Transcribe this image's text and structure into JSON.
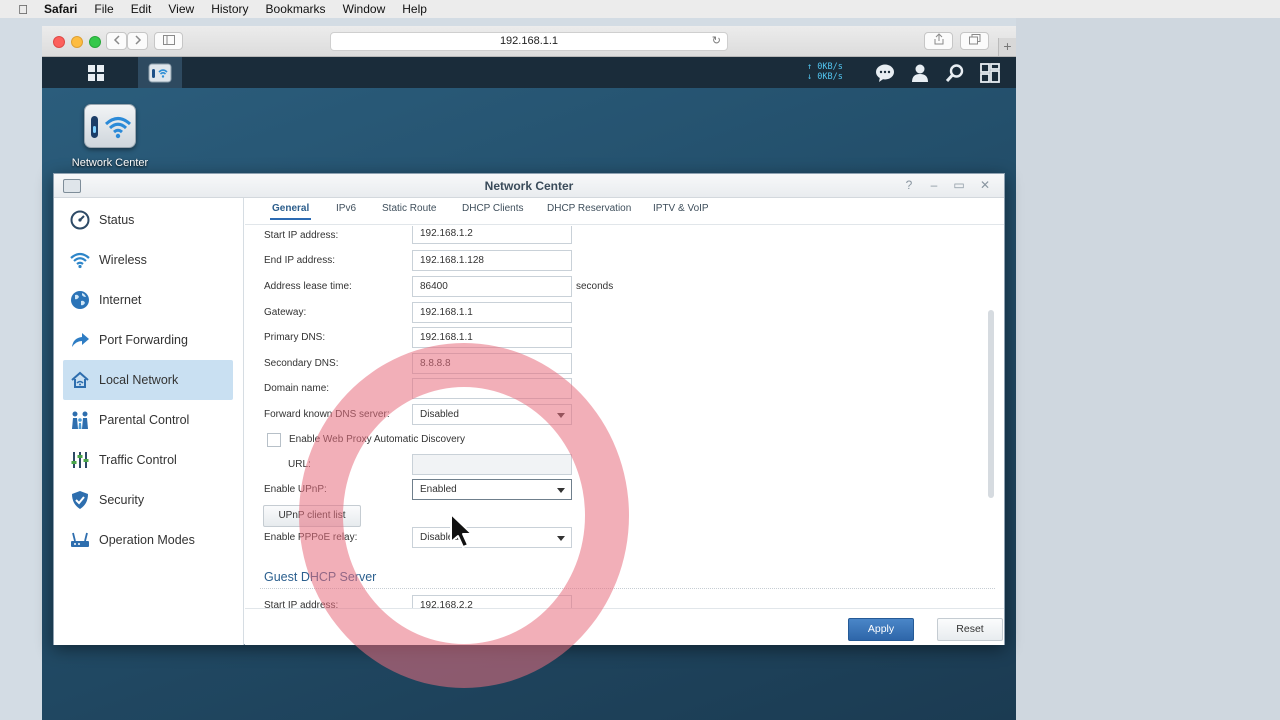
{
  "menubar": {
    "apple_icon": "apple-icon",
    "items": [
      "Safari",
      "File",
      "Edit",
      "View",
      "History",
      "Bookmarks",
      "Window",
      "Help"
    ]
  },
  "browser": {
    "url": "192.168.1.1",
    "newtab_label": "+"
  },
  "taskbar": {
    "upload_speed": "0KB/s",
    "download_speed": "0KB/s"
  },
  "desktop": {
    "icon_label": "Network Center"
  },
  "window": {
    "title": "Network Center",
    "controls": [
      "?",
      "–",
      "▭",
      "✕"
    ]
  },
  "sidebar": {
    "items": [
      {
        "label": "Status",
        "icon": "gauge-icon"
      },
      {
        "label": "Wireless",
        "icon": "wifi-icon"
      },
      {
        "label": "Internet",
        "icon": "globe-icon"
      },
      {
        "label": "Port Forwarding",
        "icon": "arrow-icon"
      },
      {
        "label": "Local Network",
        "icon": "home-icon",
        "active": true
      },
      {
        "label": "Parental Control",
        "icon": "family-icon"
      },
      {
        "label": "Traffic Control",
        "icon": "sliders-icon"
      },
      {
        "label": "Security",
        "icon": "shield-icon"
      },
      {
        "label": "Operation Modes",
        "icon": "router-icon"
      }
    ]
  },
  "tabs": [
    "General",
    "IPv6",
    "Static Route",
    "DHCP Clients",
    "DHCP Reservation",
    "IPTV & VoIP"
  ],
  "form": {
    "start_ip_label": "Start IP address:",
    "start_ip_value": "192.168.1.2",
    "end_ip_label": "End IP address:",
    "end_ip_value": "192.168.1.128",
    "lease_label": "Address lease time:",
    "lease_value": "86400",
    "lease_suffix": "seconds",
    "gateway_label": "Gateway:",
    "gateway_value": "192.168.1.1",
    "primary_dns_label": "Primary DNS:",
    "primary_dns_value": "192.168.1.1",
    "secondary_dns_label": "Secondary DNS:",
    "secondary_dns_value": "8.8.8.8",
    "domain_label": "Domain name:",
    "domain_value": "",
    "forward_dns_label": "Forward known DNS server:",
    "forward_dns_value": "Disabled",
    "wpad_label": "Enable Web Proxy Automatic Discovery",
    "url_label": "URL:",
    "url_value": "",
    "upnp_label": "Enable UPnP:",
    "upnp_value": "Enabled",
    "upnp_client_button": "UPnP client list",
    "pppoe_label": "Enable PPPoE relay:",
    "pppoe_value": "Disabled",
    "guest_section_title": "Guest DHCP Server",
    "guest_start_ip_label": "Start IP address:",
    "guest_start_ip_value": "192.168.2.2"
  },
  "footer": {
    "apply": "Apply",
    "reset": "Reset"
  }
}
